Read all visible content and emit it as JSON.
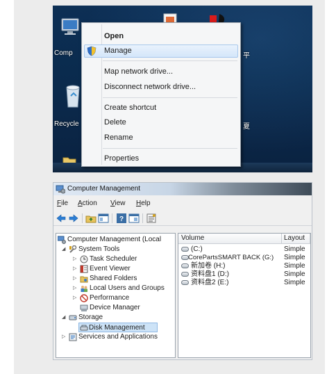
{
  "desktop": {
    "icons": [
      {
        "label": "Comp",
        "icon": "computer-icon"
      },
      {
        "label": "Recycle",
        "icon": "recycle-bin-icon"
      }
    ],
    "partial_labels": [
      "平",
      "夏"
    ],
    "context_menu": {
      "items": [
        {
          "label": "Open",
          "bold": true
        },
        {
          "label": "Manage",
          "highlighted": true,
          "icon": "uac-shield-icon"
        },
        {
          "label": "Map network drive..."
        },
        {
          "label": "Disconnect network drive..."
        },
        {
          "label": "Create shortcut"
        },
        {
          "label": "Delete"
        },
        {
          "label": "Rename"
        },
        {
          "label": "Properties"
        }
      ]
    }
  },
  "window": {
    "title": "Computer Management",
    "menu": [
      {
        "mnemonic": "F",
        "rest": "ile"
      },
      {
        "mnemonic": "A",
        "rest": "ction"
      },
      {
        "mnemonic": "V",
        "rest": "iew"
      },
      {
        "mnemonic": "H",
        "rest": "elp"
      }
    ],
    "toolbar": [
      "back-arrow-icon",
      "forward-arrow-icon",
      "up-folder-icon",
      "show-hide-tree-icon",
      "help-icon",
      "console-icon",
      "properties-icon"
    ],
    "tree": [
      {
        "label": "Computer Management (Local",
        "level": 0,
        "icon": "computer-management-icon"
      },
      {
        "label": "System Tools",
        "level": 1,
        "expanded": true,
        "icon": "tools-icon"
      },
      {
        "label": "Task Scheduler",
        "level": 2,
        "collapsed": true,
        "icon": "clock-icon"
      },
      {
        "label": "Event Viewer",
        "level": 2,
        "collapsed": true,
        "icon": "event-viewer-icon"
      },
      {
        "label": "Shared Folders",
        "level": 2,
        "collapsed": true,
        "icon": "shared-folder-icon"
      },
      {
        "label": "Local Users and Groups",
        "level": 2,
        "collapsed": true,
        "icon": "users-icon"
      },
      {
        "label": "Performance",
        "level": 2,
        "collapsed": true,
        "icon": "performance-icon"
      },
      {
        "label": "Device Manager",
        "level": 2,
        "icon": "device-manager-icon"
      },
      {
        "label": "Storage",
        "level": 1,
        "expanded": true,
        "icon": "storage-icon"
      },
      {
        "label": "Disk Management",
        "level": 2,
        "selected": true,
        "icon": "disk-management-icon"
      },
      {
        "label": "Services and Applications",
        "level": 1,
        "collapsed": true,
        "icon": "services-icon"
      }
    ],
    "columns": [
      "Volume",
      "Layout"
    ],
    "volumes": [
      {
        "volume": "(C:)",
        "layout": "Simple"
      },
      {
        "volume": "CorePartsSMART BACK (G:)",
        "layout": "Simple"
      },
      {
        "volume": "新加卷 (H:)",
        "layout": "Simple"
      },
      {
        "volume": "资料盘1 (D:)",
        "layout": "Simple"
      },
      {
        "volume": "资料盘2 (E:)",
        "layout": "Simple"
      }
    ]
  }
}
